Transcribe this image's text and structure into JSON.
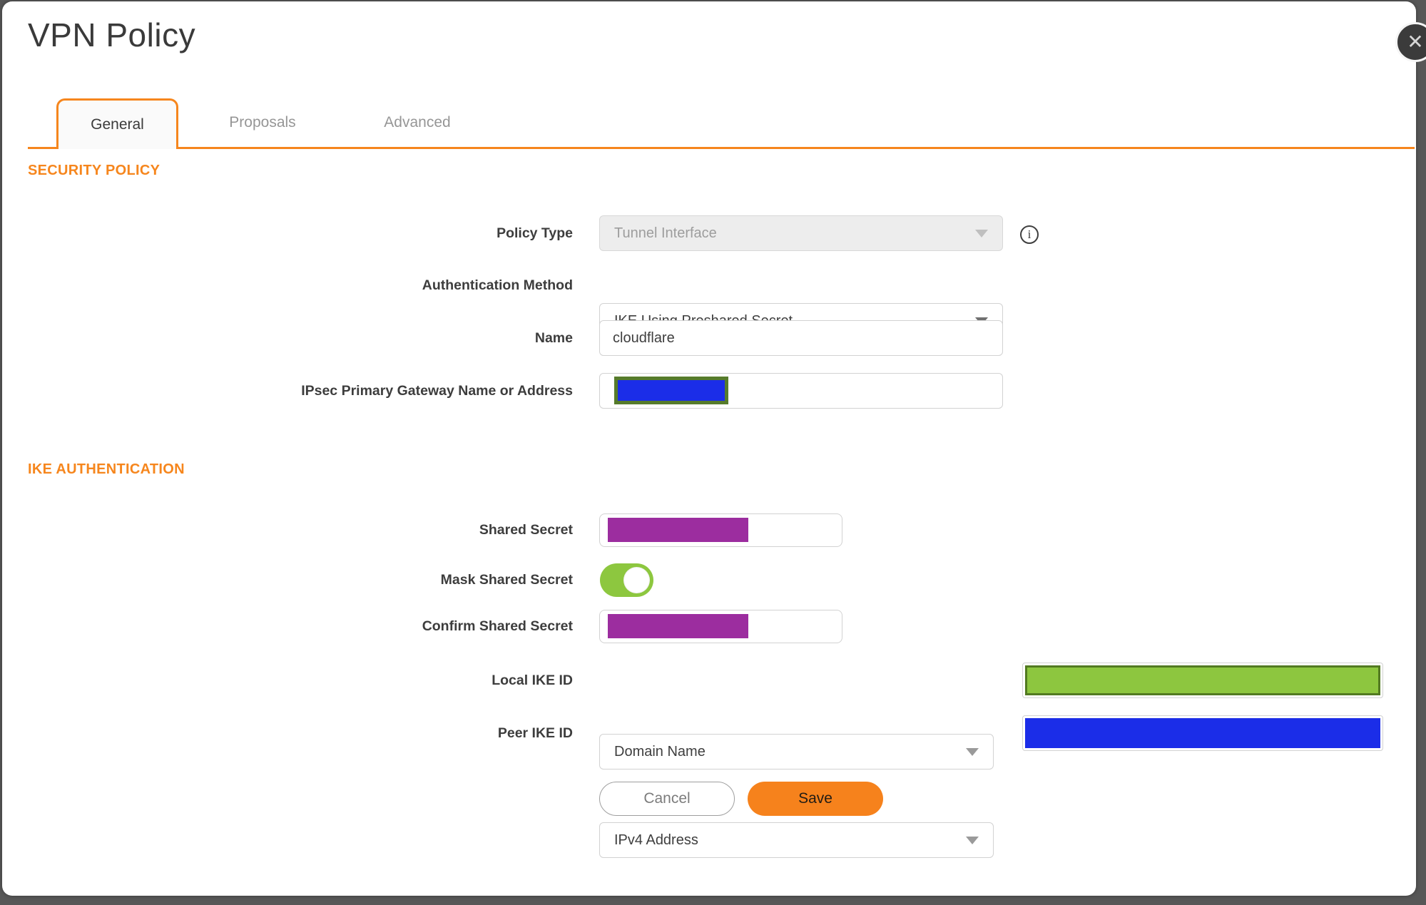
{
  "window": {
    "title": "VPN Policy",
    "close_glyph": "✕"
  },
  "tabs": {
    "general": {
      "label": "General",
      "active": true
    },
    "proposals": {
      "label": "Proposals",
      "active": false
    },
    "advanced": {
      "label": "Advanced",
      "active": false
    }
  },
  "sections": {
    "security_policy": "SECURITY POLICY",
    "ike_authentication": "IKE AUTHENTICATION"
  },
  "fields": {
    "policy_type": {
      "label": "Policy Type",
      "value": "Tunnel Interface",
      "disabled": true,
      "info_glyph": "i"
    },
    "authentication_method": {
      "label": "Authentication Method",
      "value": "IKE Using Preshared Secret"
    },
    "name": {
      "label": "Name",
      "value": "cloudflare"
    },
    "ipsec_primary_gateway": {
      "label": "IPsec Primary Gateway Name or Address",
      "value_state": "redacted"
    },
    "shared_secret": {
      "label": "Shared Secret",
      "value_state": "redacted"
    },
    "mask_shared_secret": {
      "label": "Mask Shared Secret",
      "state": "on"
    },
    "confirm_shared_secret": {
      "label": "Confirm Shared Secret",
      "value_state": "redacted"
    },
    "local_ike_id": {
      "label": "Local IKE ID",
      "value": "Domain Name",
      "id_value_state": "redacted"
    },
    "peer_ike_id": {
      "label": "Peer IKE ID",
      "value": "IPv4 Address",
      "id_value_state": "redacted"
    }
  },
  "buttons": {
    "cancel": "Cancel",
    "save": "Save"
  },
  "colors": {
    "accent_orange": "#F6861D",
    "save_orange": "#F6821C",
    "redaction_blue": "#1B2DE8",
    "redaction_purple": "#9C2D9F",
    "redaction_green": "#8DC63F",
    "redaction_green_border": "#527A21",
    "redaction_olive_border": "#567B2B",
    "toggle_on_green": "#8DC73F"
  }
}
